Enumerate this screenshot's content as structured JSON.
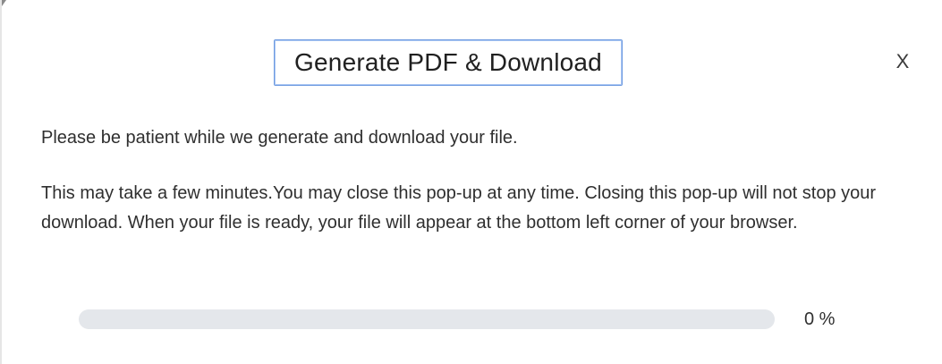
{
  "dialog": {
    "title": "Generate PDF & Download",
    "close_label": "X",
    "message_primary": "Please be patient while we generate and download your file.",
    "message_secondary": "This may take a few minutes.You may close this pop-up at any time. Closing this pop-up will not stop your download. When your file is ready, your file will appear at the bottom left corner of your browser."
  },
  "progress": {
    "value": 0,
    "label": "0 %"
  }
}
